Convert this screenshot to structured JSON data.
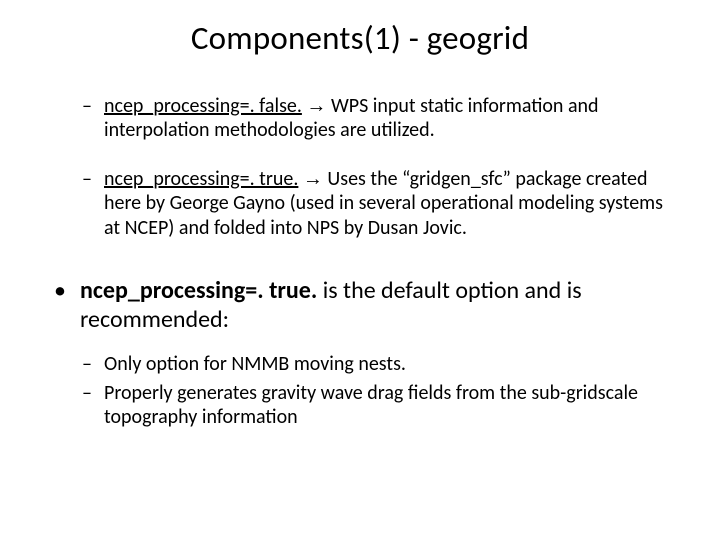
{
  "title": "Components(1) - geogrid",
  "items": [
    {
      "label": "ncep_processing=. false.",
      "rest": " WPS input static information and interpolation methodologies are utilized."
    },
    {
      "label": "ncep_processing=. true.",
      "rest": " Uses the “gridgen_sfc” package created here by George Gayno (used in several operational modeling systems at NCEP) and folded into NPS by Dusan Jovic."
    }
  ],
  "top_bullet": {
    "bold": "ncep_processing=. true.",
    "rest": " is the default option and is recommended:"
  },
  "sub_bullets": [
    "Only option for NMMB moving nests.",
    "Properly generates gravity wave drag fields from the sub-gridscale topography information"
  ],
  "glyphs": {
    "arrow": "→",
    "dash": "–",
    "dot": "•"
  }
}
